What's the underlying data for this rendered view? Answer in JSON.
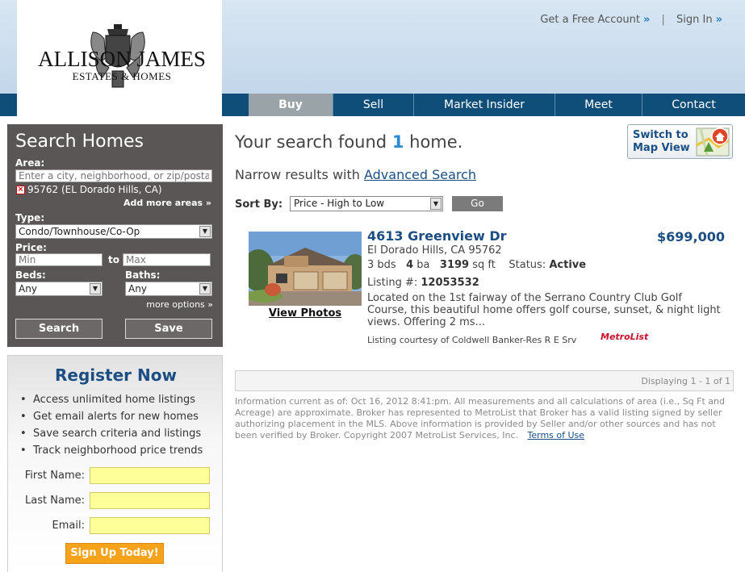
{
  "brand": {
    "name": "ALLISON JAMES",
    "sub": "ESTATES & HOMES"
  },
  "top_links": {
    "account": "Get a Free Account",
    "sign_in": "Sign In",
    "arrow": "»",
    "separator": "|"
  },
  "nav": [
    "Buy",
    "Sell",
    "Market Insider",
    "Meet",
    "Contact"
  ],
  "search": {
    "title": "Search Homes",
    "area_label": "Area:",
    "area_placeholder": "Enter a city, neighborhood, or zip/postal code",
    "area_tag": "95762 (EL Dorado Hills, CA)",
    "remove_glyph": "×",
    "add_areas": "Add more areas »",
    "type_label": "Type:",
    "type_value": "Condo/Townhouse/Co-Op",
    "price_label": "Price:",
    "min_placeholder": "Min",
    "to": "to",
    "max_placeholder": "Max",
    "beds_label": "Beds:",
    "beds_value": "Any",
    "baths_label": "Baths:",
    "baths_value": "Any",
    "more_options": "more options »",
    "search_button": "Search",
    "save_button": "Save",
    "dropdown_glyph": "▼"
  },
  "register": {
    "title": "Register Now",
    "bullet": "•",
    "benefits": [
      "Access unlimited home listings",
      "Get email alerts for new homes",
      "Save search criteria and listings",
      "Track neighborhood price trends"
    ],
    "first_name_label": "First Name:",
    "last_name_label": "Last Name:",
    "email_label": "Email:",
    "signup_button": "Sign Up Today!"
  },
  "results": {
    "title_prefix": "Your search found",
    "count": "1",
    "title_suffix": "home.",
    "narrow_prefix": "Narrow results with",
    "advanced_search": "Advanced Search",
    "map_button_line1": "Switch to",
    "map_button_line2": "Map View",
    "sort_label": "Sort By:",
    "sort_value": "Price - High to Low",
    "go_button": "Go",
    "pager_text": "Displaying 1 - 1 of 1",
    "disclaimer": "Information current as of: Oct 16, 2012 8:41:pm. All measurements and all calculations of area (i.e., Sq Ft and Acreage) are approximate. Broker has represented to MetroList that Broker has a valid listing signed by seller authorizing placement in the MLS. Above information is provided by Seller and/or other sources and has not been verified by Broker. Copyright 2007 MetroList Services, Inc.",
    "terms_link": "Terms of Use"
  },
  "listing": {
    "address": "4613 Greenview Dr",
    "price": "$699,000",
    "city": "El Dorado Hills, CA 95762",
    "beds": "3",
    "beds_unit": "bds",
    "baths": "4",
    "baths_unit": "ba",
    "sqft": "3199",
    "sqft_unit": "sq ft",
    "status_label": "Status:",
    "status": "Active",
    "mls_label": "Listing #:",
    "mls_number": "12053532",
    "description": "Located on the 1st fairway of the Serrano Country Club Golf Course, this beautiful home offers golf course, sunset, & night light views. Offering 2 ms...",
    "view_photos": "View Photos",
    "courtesy": "Listing courtesy of Coldwell Banker-Res R E Srv",
    "mls_logo": "MetroList"
  },
  "colors": {
    "nav_bg": "#0e4e78",
    "nav_active": "#9aa3a8",
    "search_panel": "#5a5655",
    "link_blue": "#1c4e84",
    "count_blue": "#2a8ad0",
    "signup_orange": "#f7a21b",
    "field_yellow": "#ffff99"
  }
}
